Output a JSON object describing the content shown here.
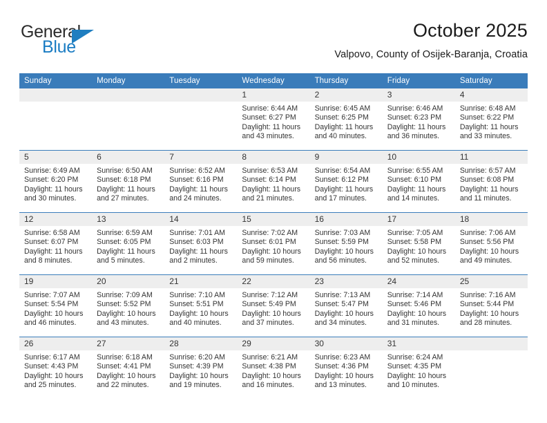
{
  "logo": {
    "word1": "General",
    "word2": "Blue",
    "triangle_color": "#1f7ec0"
  },
  "header": {
    "title": "October 2025",
    "subtitle": "Valpovo, County of Osijek-Baranja, Croatia"
  },
  "theme": {
    "header_blue": "#3a7cba",
    "daynum_band": "#eeeeee",
    "text": "#333333"
  },
  "weekday_headers": [
    "Sunday",
    "Monday",
    "Tuesday",
    "Wednesday",
    "Thursday",
    "Friday",
    "Saturday"
  ],
  "labels": {
    "sunrise_prefix": "Sunrise:",
    "sunset_prefix": "Sunset:",
    "daylight_prefix": "Daylight:"
  },
  "weeks": [
    [
      {
        "day": "",
        "empty": true
      },
      {
        "day": "",
        "empty": true
      },
      {
        "day": "",
        "empty": true
      },
      {
        "day": "1",
        "sunrise": "Sunrise: 6:44 AM",
        "sunset": "Sunset: 6:27 PM",
        "daylight_line1": "Daylight: 11 hours",
        "daylight_line2": "and 43 minutes."
      },
      {
        "day": "2",
        "sunrise": "Sunrise: 6:45 AM",
        "sunset": "Sunset: 6:25 PM",
        "daylight_line1": "Daylight: 11 hours",
        "daylight_line2": "and 40 minutes."
      },
      {
        "day": "3",
        "sunrise": "Sunrise: 6:46 AM",
        "sunset": "Sunset: 6:23 PM",
        "daylight_line1": "Daylight: 11 hours",
        "daylight_line2": "and 36 minutes."
      },
      {
        "day": "4",
        "sunrise": "Sunrise: 6:48 AM",
        "sunset": "Sunset: 6:22 PM",
        "daylight_line1": "Daylight: 11 hours",
        "daylight_line2": "and 33 minutes."
      }
    ],
    [
      {
        "day": "5",
        "sunrise": "Sunrise: 6:49 AM",
        "sunset": "Sunset: 6:20 PM",
        "daylight_line1": "Daylight: 11 hours",
        "daylight_line2": "and 30 minutes."
      },
      {
        "day": "6",
        "sunrise": "Sunrise: 6:50 AM",
        "sunset": "Sunset: 6:18 PM",
        "daylight_line1": "Daylight: 11 hours",
        "daylight_line2": "and 27 minutes."
      },
      {
        "day": "7",
        "sunrise": "Sunrise: 6:52 AM",
        "sunset": "Sunset: 6:16 PM",
        "daylight_line1": "Daylight: 11 hours",
        "daylight_line2": "and 24 minutes."
      },
      {
        "day": "8",
        "sunrise": "Sunrise: 6:53 AM",
        "sunset": "Sunset: 6:14 PM",
        "daylight_line1": "Daylight: 11 hours",
        "daylight_line2": "and 21 minutes."
      },
      {
        "day": "9",
        "sunrise": "Sunrise: 6:54 AM",
        "sunset": "Sunset: 6:12 PM",
        "daylight_line1": "Daylight: 11 hours",
        "daylight_line2": "and 17 minutes."
      },
      {
        "day": "10",
        "sunrise": "Sunrise: 6:55 AM",
        "sunset": "Sunset: 6:10 PM",
        "daylight_line1": "Daylight: 11 hours",
        "daylight_line2": "and 14 minutes."
      },
      {
        "day": "11",
        "sunrise": "Sunrise: 6:57 AM",
        "sunset": "Sunset: 6:08 PM",
        "daylight_line1": "Daylight: 11 hours",
        "daylight_line2": "and 11 minutes."
      }
    ],
    [
      {
        "day": "12",
        "sunrise": "Sunrise: 6:58 AM",
        "sunset": "Sunset: 6:07 PM",
        "daylight_line1": "Daylight: 11 hours",
        "daylight_line2": "and 8 minutes."
      },
      {
        "day": "13",
        "sunrise": "Sunrise: 6:59 AM",
        "sunset": "Sunset: 6:05 PM",
        "daylight_line1": "Daylight: 11 hours",
        "daylight_line2": "and 5 minutes."
      },
      {
        "day": "14",
        "sunrise": "Sunrise: 7:01 AM",
        "sunset": "Sunset: 6:03 PM",
        "daylight_line1": "Daylight: 11 hours",
        "daylight_line2": "and 2 minutes."
      },
      {
        "day": "15",
        "sunrise": "Sunrise: 7:02 AM",
        "sunset": "Sunset: 6:01 PM",
        "daylight_line1": "Daylight: 10 hours",
        "daylight_line2": "and 59 minutes."
      },
      {
        "day": "16",
        "sunrise": "Sunrise: 7:03 AM",
        "sunset": "Sunset: 5:59 PM",
        "daylight_line1": "Daylight: 10 hours",
        "daylight_line2": "and 56 minutes."
      },
      {
        "day": "17",
        "sunrise": "Sunrise: 7:05 AM",
        "sunset": "Sunset: 5:58 PM",
        "daylight_line1": "Daylight: 10 hours",
        "daylight_line2": "and 52 minutes."
      },
      {
        "day": "18",
        "sunrise": "Sunrise: 7:06 AM",
        "sunset": "Sunset: 5:56 PM",
        "daylight_line1": "Daylight: 10 hours",
        "daylight_line2": "and 49 minutes."
      }
    ],
    [
      {
        "day": "19",
        "sunrise": "Sunrise: 7:07 AM",
        "sunset": "Sunset: 5:54 PM",
        "daylight_line1": "Daylight: 10 hours",
        "daylight_line2": "and 46 minutes."
      },
      {
        "day": "20",
        "sunrise": "Sunrise: 7:09 AM",
        "sunset": "Sunset: 5:52 PM",
        "daylight_line1": "Daylight: 10 hours",
        "daylight_line2": "and 43 minutes."
      },
      {
        "day": "21",
        "sunrise": "Sunrise: 7:10 AM",
        "sunset": "Sunset: 5:51 PM",
        "daylight_line1": "Daylight: 10 hours",
        "daylight_line2": "and 40 minutes."
      },
      {
        "day": "22",
        "sunrise": "Sunrise: 7:12 AM",
        "sunset": "Sunset: 5:49 PM",
        "daylight_line1": "Daylight: 10 hours",
        "daylight_line2": "and 37 minutes."
      },
      {
        "day": "23",
        "sunrise": "Sunrise: 7:13 AM",
        "sunset": "Sunset: 5:47 PM",
        "daylight_line1": "Daylight: 10 hours",
        "daylight_line2": "and 34 minutes."
      },
      {
        "day": "24",
        "sunrise": "Sunrise: 7:14 AM",
        "sunset": "Sunset: 5:46 PM",
        "daylight_line1": "Daylight: 10 hours",
        "daylight_line2": "and 31 minutes."
      },
      {
        "day": "25",
        "sunrise": "Sunrise: 7:16 AM",
        "sunset": "Sunset: 5:44 PM",
        "daylight_line1": "Daylight: 10 hours",
        "daylight_line2": "and 28 minutes."
      }
    ],
    [
      {
        "day": "26",
        "sunrise": "Sunrise: 6:17 AM",
        "sunset": "Sunset: 4:43 PM",
        "daylight_line1": "Daylight: 10 hours",
        "daylight_line2": "and 25 minutes."
      },
      {
        "day": "27",
        "sunrise": "Sunrise: 6:18 AM",
        "sunset": "Sunset: 4:41 PM",
        "daylight_line1": "Daylight: 10 hours",
        "daylight_line2": "and 22 minutes."
      },
      {
        "day": "28",
        "sunrise": "Sunrise: 6:20 AM",
        "sunset": "Sunset: 4:39 PM",
        "daylight_line1": "Daylight: 10 hours",
        "daylight_line2": "and 19 minutes."
      },
      {
        "day": "29",
        "sunrise": "Sunrise: 6:21 AM",
        "sunset": "Sunset: 4:38 PM",
        "daylight_line1": "Daylight: 10 hours",
        "daylight_line2": "and 16 minutes."
      },
      {
        "day": "30",
        "sunrise": "Sunrise: 6:23 AM",
        "sunset": "Sunset: 4:36 PM",
        "daylight_line1": "Daylight: 10 hours",
        "daylight_line2": "and 13 minutes."
      },
      {
        "day": "31",
        "sunrise": "Sunrise: 6:24 AM",
        "sunset": "Sunset: 4:35 PM",
        "daylight_line1": "Daylight: 10 hours",
        "daylight_line2": "and 10 minutes."
      },
      {
        "day": "",
        "empty": true
      }
    ]
  ]
}
